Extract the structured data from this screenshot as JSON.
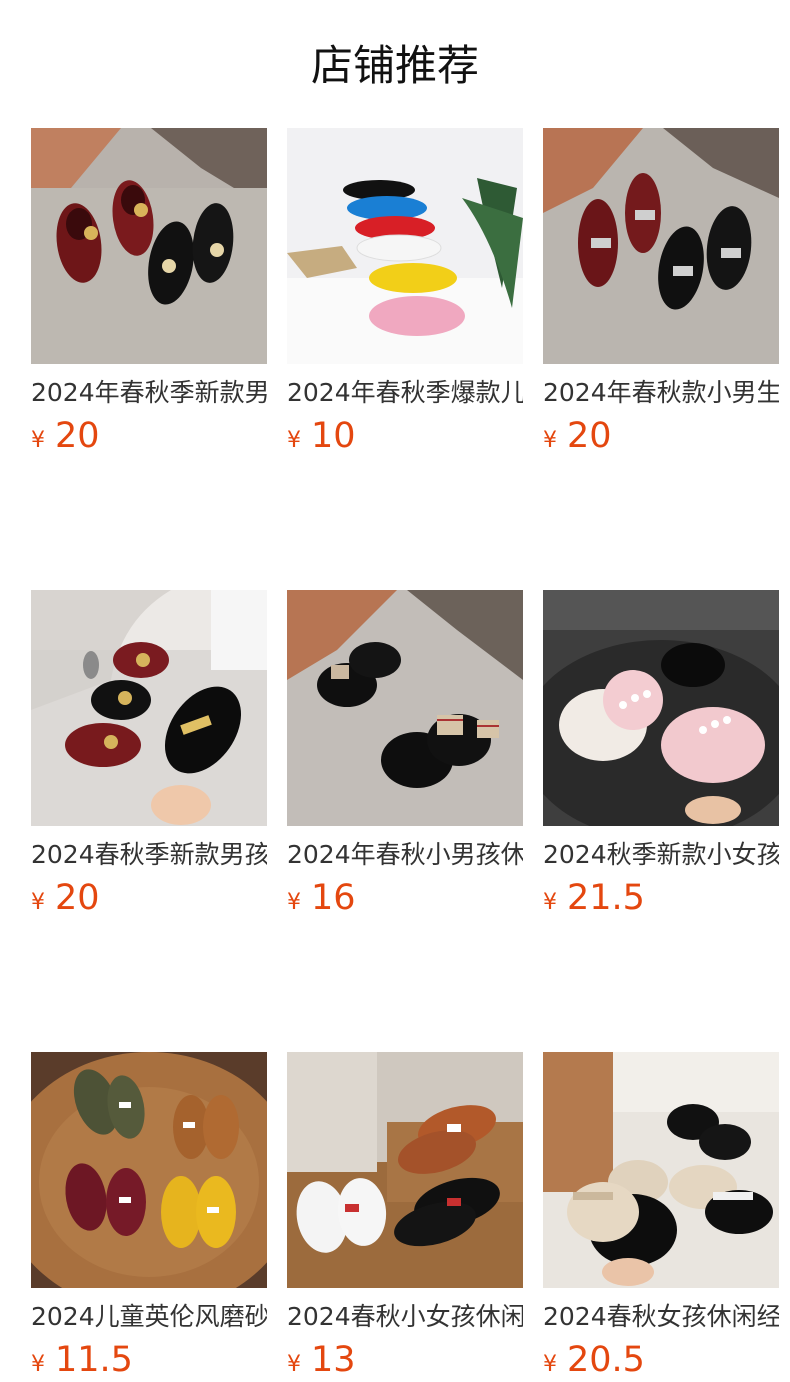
{
  "page_title": "店铺推荐",
  "colors": {
    "price": "#e4470f",
    "title": "#111111",
    "name": "#333333"
  },
  "products": [
    {
      "name": "2024年春秋季新款男",
      "currency": "¥",
      "price": "20",
      "image": "product-photo"
    },
    {
      "name": "2024年春秋季爆款儿",
      "currency": "¥",
      "price": "10",
      "image": "product-photo"
    },
    {
      "name": "2024年春秋款小男生",
      "currency": "¥",
      "price": "20",
      "image": "product-photo"
    },
    {
      "name": "2024春秋季新款男孩",
      "currency": "¥",
      "price": "20",
      "image": "product-photo"
    },
    {
      "name": "2024年春秋小男孩休",
      "currency": "¥",
      "price": "16",
      "image": "product-photo"
    },
    {
      "name": "2024秋季新款小女孩",
      "currency": "¥",
      "price": "21.5",
      "image": "product-photo"
    },
    {
      "name": "2024儿童英伦风磨砂",
      "currency": "¥",
      "price": "11.5",
      "image": "product-photo"
    },
    {
      "name": "2024春秋小女孩休闲",
      "currency": "¥",
      "price": "13",
      "image": "product-photo"
    },
    {
      "name": "2024春秋女孩休闲经",
      "currency": "¥",
      "price": "20.5",
      "image": "product-photo"
    }
  ]
}
